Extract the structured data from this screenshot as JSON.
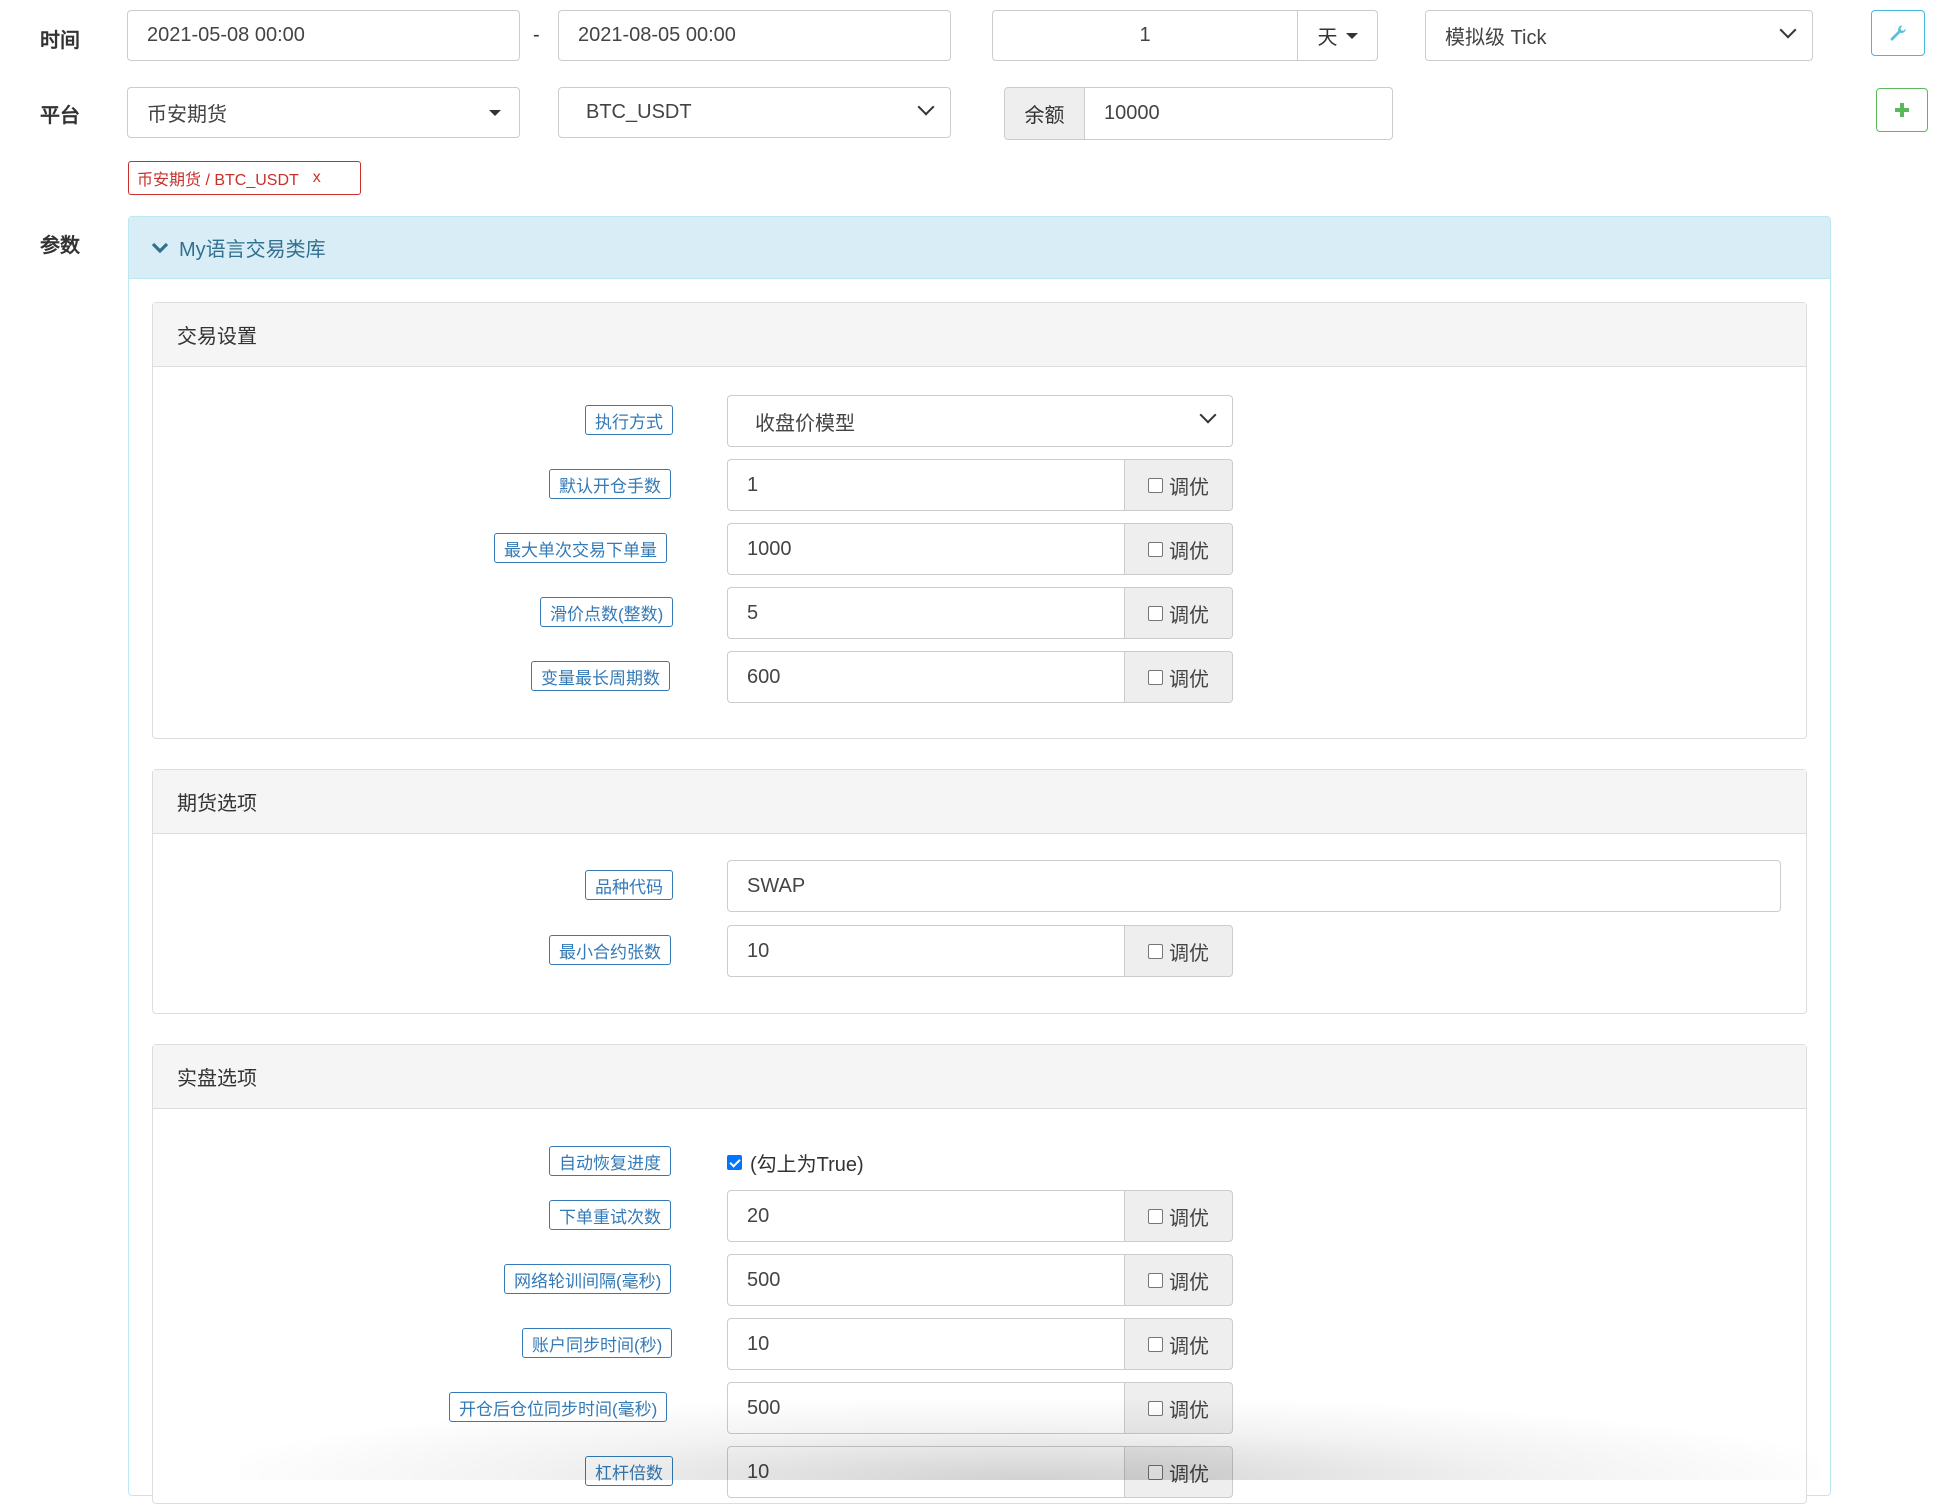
{
  "top": {
    "time_label": "时间",
    "start_time": "2021-05-08 00:00",
    "dash": "-",
    "end_time": "2021-08-05 00:00",
    "period_value": "1",
    "period_unit": "天",
    "tick_mode": "模拟级 Tick",
    "platform_label": "平台",
    "exchange": "币安期货",
    "pair": "BTC_USDT",
    "balance_label": "余额",
    "balance_value": "10000",
    "tag_text": "币安期货 / BTC_USDT",
    "tag_close": "x",
    "params_label": "参数"
  },
  "library": {
    "title": "My语言交易类库"
  },
  "tune_label": "调优",
  "sections": {
    "trade": {
      "title": "交易设置",
      "exec_label": "执行方式",
      "exec_value": "收盘价模型",
      "rows": [
        {
          "label": "默认开仓手数",
          "value": "1"
        },
        {
          "label": "最大单次交易下单量",
          "value": "1000"
        },
        {
          "label": "滑价点数(整数)",
          "value": "5"
        },
        {
          "label": "变量最长周期数",
          "value": "600"
        }
      ]
    },
    "futures": {
      "title": "期货选项",
      "code_label": "品种代码",
      "code_value": "SWAP",
      "rows": [
        {
          "label": "最小合约张数",
          "value": "10"
        }
      ]
    },
    "live": {
      "title": "实盘选项",
      "auto_label": "自动恢复进度",
      "auto_text": "(勾上为True)",
      "rows": [
        {
          "label": "下单重试次数",
          "value": "20"
        },
        {
          "label": "网络轮训间隔(毫秒)",
          "value": "500"
        },
        {
          "label": "账户同步时间(秒)",
          "value": "10"
        },
        {
          "label": "开仓后仓位同步时间(毫秒)",
          "value": "500"
        },
        {
          "label": "杠杆倍数",
          "value": "10"
        }
      ]
    }
  },
  "colors": {
    "primary": "#337ab7",
    "danger": "#c9302c",
    "success": "#5cb85c",
    "info_bg": "#d9edf7"
  }
}
